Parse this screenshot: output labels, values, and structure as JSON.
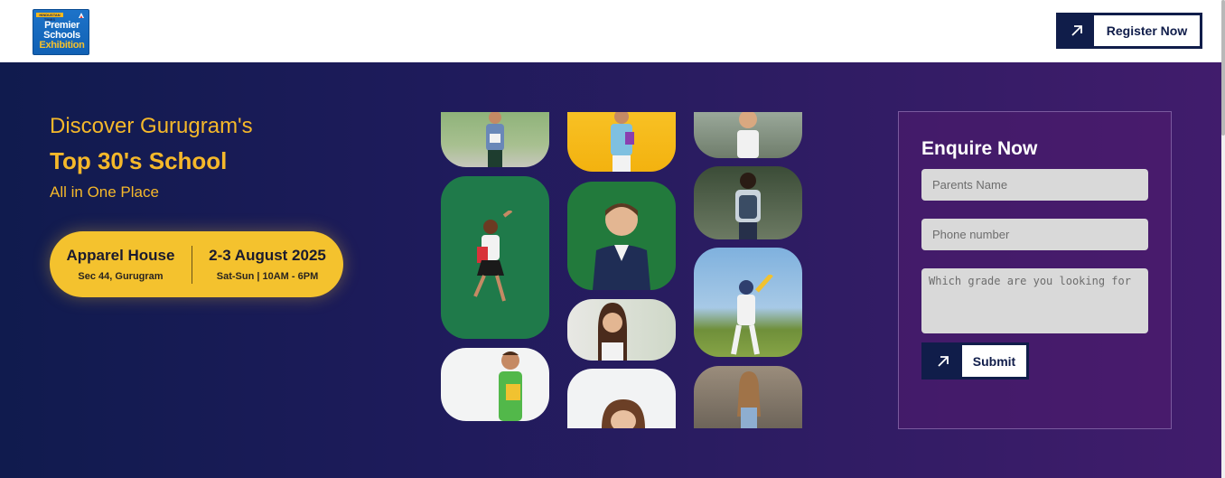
{
  "logo": {
    "tag": "HINDUSTAN TIMES",
    "line1": "Premier",
    "line2": "Schools",
    "line3": "Exhibition"
  },
  "header": {
    "register_label": "Register Now",
    "register_icon": "arrow-up-right-icon"
  },
  "hero": {
    "line1": "Discover Gurugram's",
    "line2": "Top 30's School",
    "line3": "All in One Place",
    "venue": {
      "title": "Apparel House",
      "subtitle": "Sec 44, Gurugram"
    },
    "date": {
      "title": "2-3 August 2025",
      "subtitle": "Sat-Sun | 10AM - 6PM"
    }
  },
  "enquire": {
    "title": "Enquire Now",
    "parents_placeholder": "Parents Name",
    "phone_placeholder": "Phone number",
    "grade_placeholder": "Which grade are you looking for",
    "submit_label": "Submit",
    "submit_icon": "arrow-up-right-icon"
  },
  "colors": {
    "accent_yellow": "#f4c22e",
    "navy": "#101d4a",
    "hero_start": "#101b4e",
    "hero_end": "#411c6c"
  }
}
